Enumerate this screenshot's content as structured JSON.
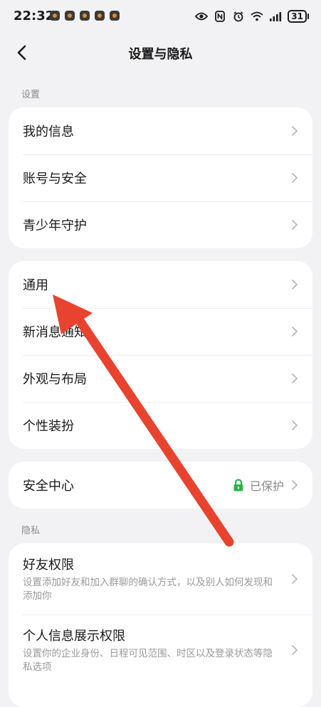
{
  "status_bar": {
    "time": "22:32",
    "battery": "31"
  },
  "header": {
    "title": "设置与隐私"
  },
  "sections": {
    "settings_label": "设置",
    "privacy_label": "隐私"
  },
  "card1": {
    "items": [
      {
        "label": "我的信息"
      },
      {
        "label": "账号与安全"
      },
      {
        "label": "青少年守护"
      }
    ]
  },
  "card2": {
    "items": [
      {
        "label": "通用"
      },
      {
        "label": "新消息通知"
      },
      {
        "label": "外观与布局"
      },
      {
        "label": "个性装扮"
      }
    ]
  },
  "card3": {
    "label": "安全中心",
    "status": "已保护"
  },
  "card4": {
    "items": [
      {
        "label": "好友权限",
        "desc": "设置添加好友和加入群聊的确认方式，以及别人如何发现和添加你"
      },
      {
        "label": "个人信息展示权限",
        "desc": "设置你的企业身份、日程可见范围、时区以及登录状态等隐私选项"
      }
    ]
  },
  "colors": {
    "background": "#f2f2f4",
    "card": "#ffffff",
    "secondary_text": "#8a8a8f",
    "lock_green": "#2fb24c",
    "annotation_red": "#e8432e"
  },
  "icons": {
    "back": "chevron-left-icon",
    "chevron": "chevron-right-icon",
    "lock": "lock-icon"
  }
}
